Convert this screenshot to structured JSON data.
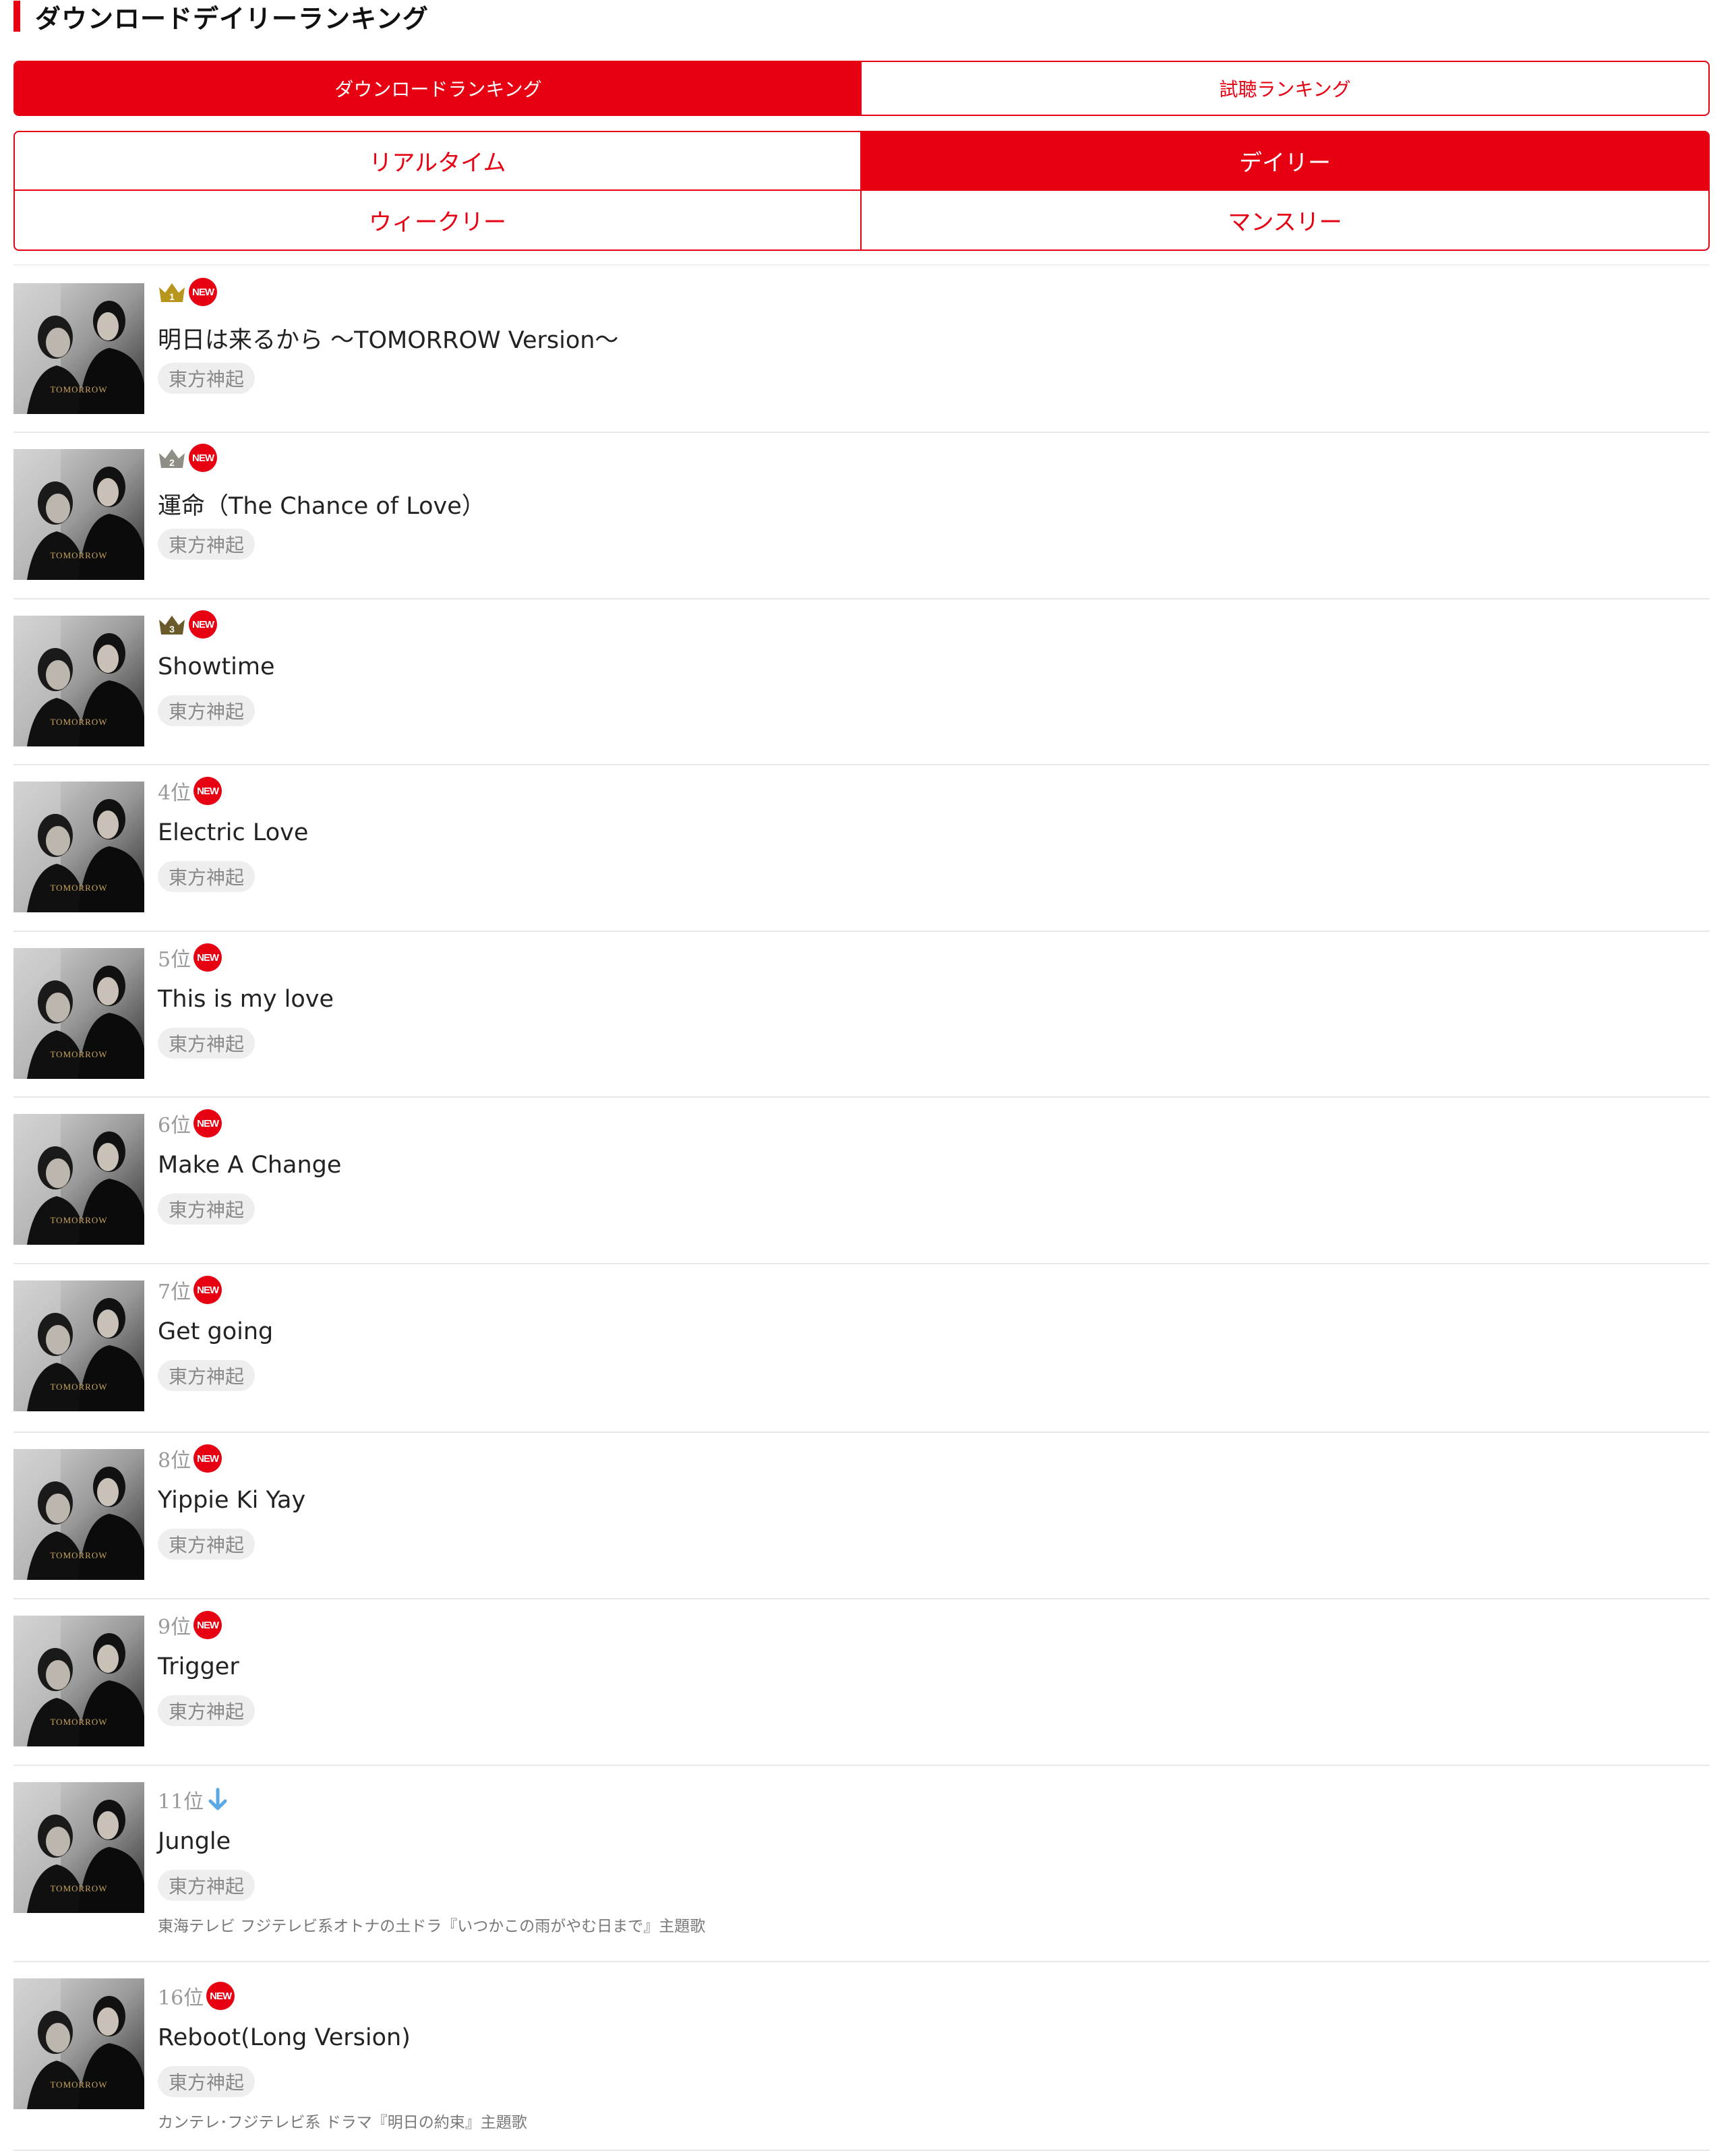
{
  "heading": "ダウンロードデイリーランキング",
  "tabs_type": [
    {
      "label": "ダウンロードランキング",
      "active": true
    },
    {
      "label": "試聴ランキング",
      "active": false
    }
  ],
  "tabs_period": [
    {
      "label": "リアルタイム",
      "active": false
    },
    {
      "label": "デイリー",
      "active": true
    },
    {
      "label": "ウィークリー",
      "active": false
    },
    {
      "label": "マンスリー",
      "active": false
    }
  ],
  "colors": {
    "accent": "#e60012",
    "gold": "#b8961e",
    "silver": "#8e8e86",
    "bronze": "#6b5a2a",
    "arrow": "#5aa9e6"
  },
  "album_label": "TOMORROW",
  "new_label": "NEW",
  "items": [
    {
      "rank": 1,
      "rank_label": "1",
      "title": "明日は来るから 〜TOMORROW Version〜",
      "artist": "東方神起",
      "new": true,
      "note": ""
    },
    {
      "rank": 2,
      "rank_label": "2",
      "title": "運命（The Chance of Love）",
      "artist": "東方神起",
      "new": true,
      "note": ""
    },
    {
      "rank": 3,
      "rank_label": "3",
      "title": "Showtime",
      "artist": "東方神起",
      "new": true,
      "note": ""
    },
    {
      "rank": 4,
      "rank_label": "4位",
      "title": "Electric Love",
      "artist": "東方神起",
      "new": true,
      "note": ""
    },
    {
      "rank": 5,
      "rank_label": "5位",
      "title": "This is my love",
      "artist": "東方神起",
      "new": true,
      "note": ""
    },
    {
      "rank": 6,
      "rank_label": "6位",
      "title": "Make A Change",
      "artist": "東方神起",
      "new": true,
      "note": ""
    },
    {
      "rank": 7,
      "rank_label": "7位",
      "title": "Get going",
      "artist": "東方神起",
      "new": true,
      "note": ""
    },
    {
      "rank": 8,
      "rank_label": "8位",
      "title": "Yippie Ki Yay",
      "artist": "東方神起",
      "new": true,
      "note": ""
    },
    {
      "rank": 9,
      "rank_label": "9位",
      "title": "Trigger",
      "artist": "東方神起",
      "new": true,
      "note": ""
    },
    {
      "rank": 11,
      "rank_label": "11位",
      "title": "Jungle",
      "artist": "東方神起",
      "new": false,
      "trend": "down",
      "note": "東海テレビ フジテレビ系オトナの土ドラ『いつかこの雨がやむ日まで』主題歌"
    },
    {
      "rank": 16,
      "rank_label": "16位",
      "title": "Reboot(Long Version)",
      "artist": "東方神起",
      "new": true,
      "note": "カンテレ･フジテレビ系 ドラマ『明日の約束』主題歌"
    }
  ]
}
